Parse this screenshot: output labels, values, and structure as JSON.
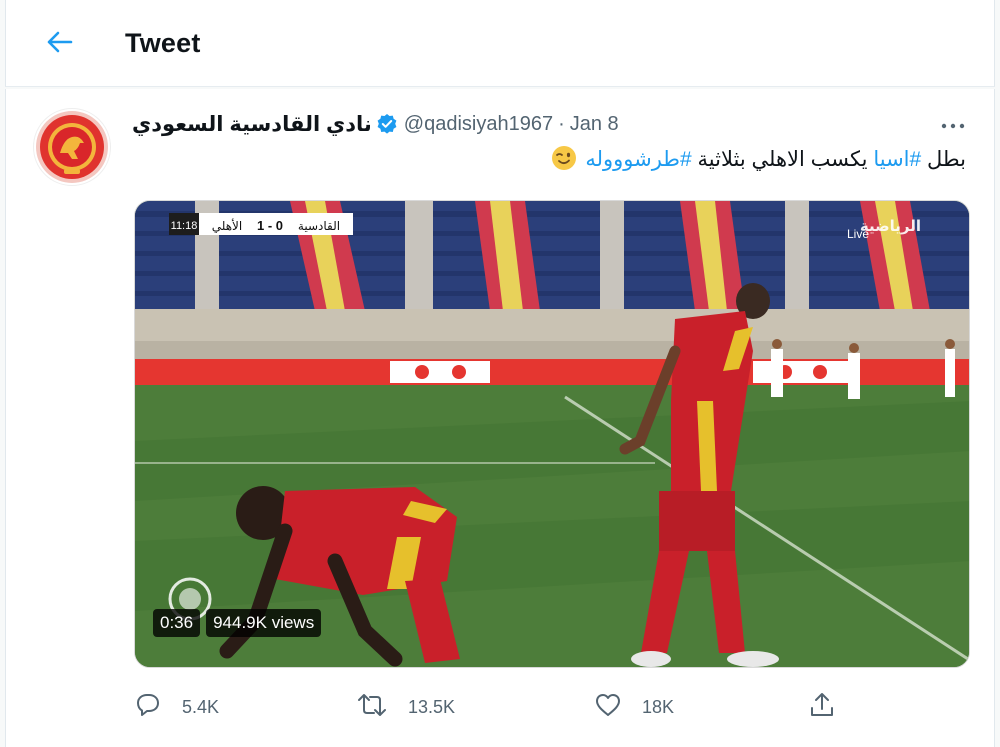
{
  "header": {
    "back_icon": "arrow-left-icon",
    "title": "Tweet"
  },
  "tweet": {
    "display_name": "نادي القادسية السعودي",
    "verified_icon": "verified-badge-icon",
    "handle": "@qadisiyah1967",
    "separator": "·",
    "date": "Jan 8",
    "more_icon": "more-dots-icon",
    "text_prefix": "بطل ",
    "hashtag1": "#اسيا",
    "text_middle": " يكسب الاهلي بثلاثية ",
    "hashtag2": "#طرشوووله",
    "emoji": "winking-face-emoji",
    "colors": {
      "link": "#1d9bf0",
      "muted": "#536471",
      "verified": "#1d9bf0"
    }
  },
  "video": {
    "duration": "0:36",
    "views": "944.9K views",
    "score_home": "القادسية",
    "score": "1 - 0",
    "score_away": "الأهلي",
    "clock": "11:18",
    "live_label": "Live",
    "broadcaster": "الرياضية"
  },
  "actions": {
    "reply_count": "5.4K",
    "retweet_count": "13.5K",
    "like_count": "18K",
    "icons": [
      "reply-icon",
      "retweet-icon",
      "like-icon",
      "share-icon"
    ]
  }
}
